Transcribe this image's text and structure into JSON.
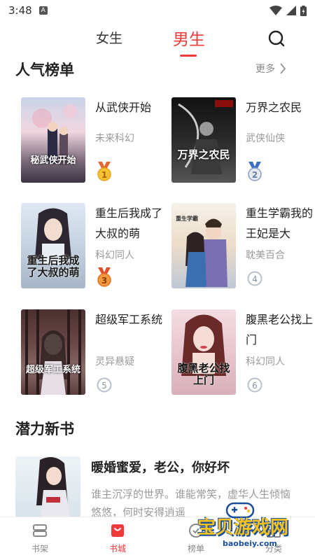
{
  "status_bar": {
    "time": "3:48",
    "notif_letter": "A"
  },
  "tabs": {
    "female": "女生",
    "male": "男生"
  },
  "popular": {
    "title": "人气榜单",
    "more": "更多",
    "books": [
      {
        "title": "从武侠开始",
        "genre": "未来科幻",
        "rank": "1",
        "cover_text": "秘武侠开始"
      },
      {
        "title": "万界之农民",
        "genre": "武侠仙侠",
        "rank": "2",
        "cover_text": "万界之农民"
      },
      {
        "title": "重生后我成了大叔的萌",
        "genre": "科幻同人",
        "rank": "3",
        "cover_text": "重生后我成了大叔的萌"
      },
      {
        "title": "重生学霸我的王妃是大",
        "genre": "耽美百合",
        "rank": "4",
        "cover_text": "重生学霸"
      },
      {
        "title": "超级军工系统",
        "genre": "灵异悬疑",
        "rank": "5",
        "cover_text": "超级军工系统"
      },
      {
        "title": "腹黑老公找上门",
        "genre": "科幻同人",
        "rank": "6",
        "cover_text": "腹黑老公找上门"
      }
    ]
  },
  "new_books": {
    "title": "潜力新书",
    "item": {
      "title": "暖婚蜜爱，老公，你好坏",
      "desc": "谁主沉浮的世界。谁能常笑，虚华人生倾恼悠悠，何时安得逍遥"
    }
  },
  "bottom_nav": {
    "shelf": "书架",
    "store": "书城",
    "rank": "榜单",
    "category": "分类"
  },
  "watermark": {
    "text": "宝贝游戏网",
    "url": "baobeiy.com"
  },
  "colors": {
    "accent": "#ee3a3a",
    "gold": "#e8a21c",
    "silver": "#8aa0c0",
    "bronze": "#e0702a"
  }
}
